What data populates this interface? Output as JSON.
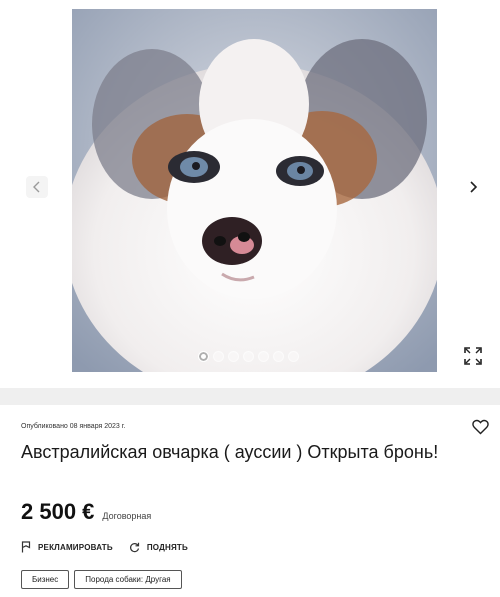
{
  "gallery": {
    "photo_alt": "puppy-photo",
    "total_photos": 7,
    "active_index": 0,
    "prev_icon": "chevron-left-icon",
    "next_icon": "chevron-right-icon",
    "expand_icon": "expand-icon"
  },
  "listing": {
    "published": "Опубликовано 08 января 2023 г.",
    "title": "Австралийская овчарка ( ауссии ) Открыта бронь!",
    "price": "2 500 €",
    "price_note": "Договорная",
    "favorite_icon": "heart-icon"
  },
  "actions": {
    "promote_label": "РЕКЛАМИРОВАТЬ",
    "promote_icon": "flag-icon",
    "bump_label": "ПОДНЯТЬ",
    "bump_icon": "refresh-icon"
  },
  "tags": [
    {
      "label": "Бизнес"
    },
    {
      "label": "Порода собаки: Другая"
    }
  ]
}
